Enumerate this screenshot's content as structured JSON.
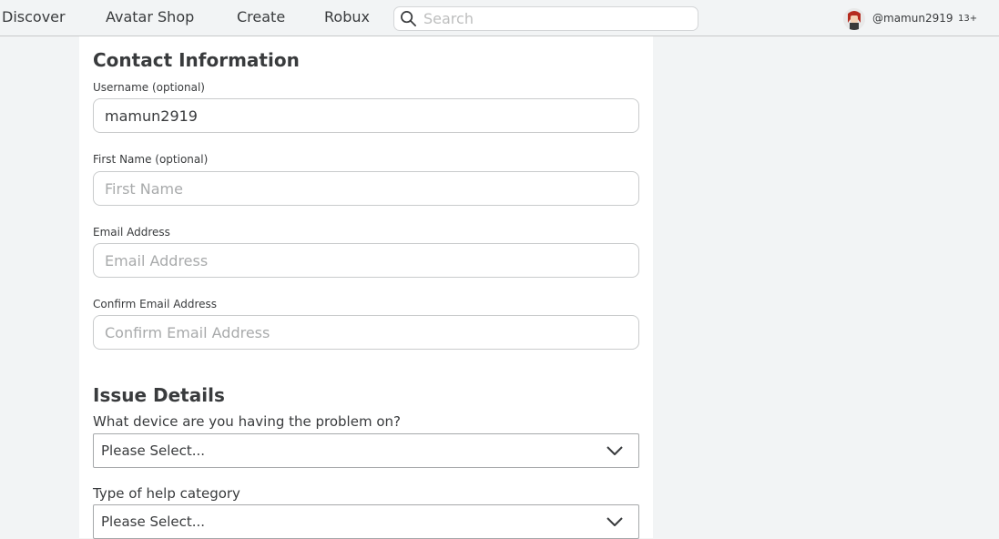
{
  "nav": {
    "links": [
      "Discover",
      "Avatar Shop",
      "Create",
      "Robux"
    ],
    "search_placeholder": "Search",
    "username": "@mamun2919",
    "age_badge": "13+"
  },
  "contact": {
    "title": "Contact Information",
    "username_label": "Username (optional)",
    "username_value": "mamun2919",
    "first_name_label": "First Name (optional)",
    "first_name_placeholder": "First Name",
    "email_label": "Email Address",
    "email_placeholder": "Email Address",
    "confirm_email_label": "Confirm Email Address",
    "confirm_email_placeholder": "Confirm Email Address"
  },
  "issue": {
    "title": "Issue Details",
    "device_question": "What device are you having the problem on?",
    "device_selected": "Please Select...",
    "category_question": "Type of help category",
    "category_selected": "Please Select..."
  },
  "icons": {
    "search": "search-icon",
    "chevron": "chevron-down-icon",
    "avatar": "avatar"
  }
}
